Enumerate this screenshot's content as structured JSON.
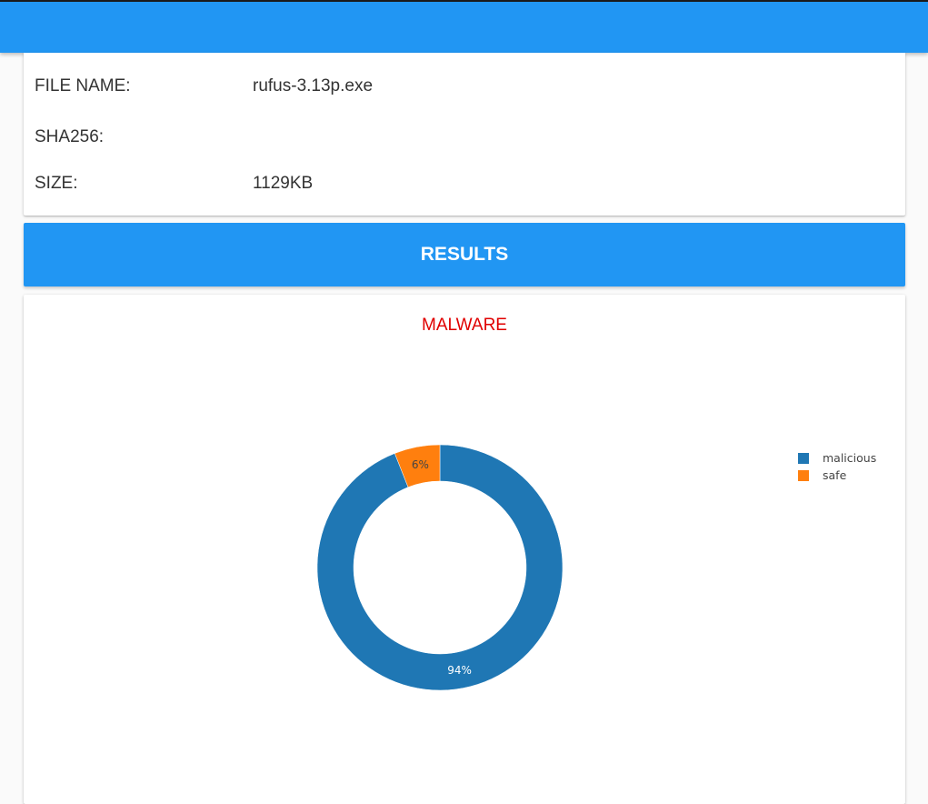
{
  "file_info": {
    "file_name_label": "FILE NAME:",
    "file_name_value": "rufus-3.13p.exe",
    "sha256_label": "SHA256:",
    "sha256_value": "",
    "size_label": "SIZE:",
    "size_value": "1129KB"
  },
  "results_button": {
    "label": "RESULTS"
  },
  "verdict": {
    "text": "MALWARE",
    "color": "#e00000"
  },
  "colors": {
    "accent": "#2196f3",
    "malicious": "#1f77b4",
    "safe": "#ff7f0e"
  },
  "chart_data": {
    "type": "pie",
    "style": "donut",
    "categories": [
      "malicious",
      "safe"
    ],
    "values": [
      94,
      6
    ],
    "data_labels": [
      "94%",
      "6%"
    ],
    "colors": [
      "#1f77b4",
      "#ff7f0e"
    ],
    "legend_position": "right",
    "title": ""
  }
}
